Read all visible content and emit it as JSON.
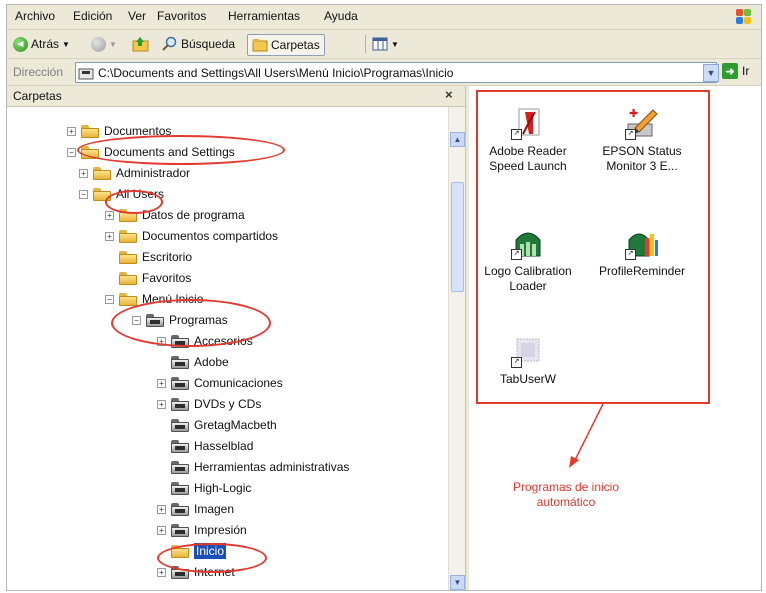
{
  "menubar": {
    "items": [
      "Archivo",
      "Edición",
      "Ver",
      "Favoritos",
      "Herramientas",
      "Ayuda"
    ]
  },
  "toolbar": {
    "back_label": "Atrás",
    "search_label": "Búsqueda",
    "folders_label": "Carpetas"
  },
  "address": {
    "label": "Dirección",
    "path": "C:\\Documents and Settings\\All Users\\Menú Inicio\\Programas\\Inicio",
    "go_label": "Ir"
  },
  "folders_pane": {
    "title": "Carpetas",
    "close": "×"
  },
  "tree": [
    {
      "label": "Documentos",
      "expander": "+",
      "type": "folder"
    },
    {
      "label": "Documents and Settings",
      "expander": "−",
      "type": "folder"
    },
    {
      "label": "Administrador",
      "expander": "+",
      "type": "folder"
    },
    {
      "label": "All Users",
      "expander": "−",
      "type": "folder"
    },
    {
      "label": "Datos de programa",
      "expander": "+",
      "type": "folder"
    },
    {
      "label": "Documentos compartidos",
      "expander": "+",
      "type": "folder"
    },
    {
      "label": "Escritorio",
      "expander": "",
      "type": "folder"
    },
    {
      "label": "Favoritos",
      "expander": "",
      "type": "folder"
    },
    {
      "label": "Menú Inicio",
      "expander": "−",
      "type": "folder"
    },
    {
      "label": "Programas",
      "expander": "−",
      "type": "prog"
    },
    {
      "label": "Accesorios",
      "expander": "+",
      "type": "prog"
    },
    {
      "label": "Adobe",
      "expander": "",
      "type": "prog"
    },
    {
      "label": "Comunicaciones",
      "expander": "+",
      "type": "prog"
    },
    {
      "label": "DVDs y CDs",
      "expander": "+",
      "type": "prog"
    },
    {
      "label": "GretagMacbeth",
      "expander": "",
      "type": "prog"
    },
    {
      "label": "Hasselblad",
      "expander": "",
      "type": "prog"
    },
    {
      "label": "Herramientas administrativas",
      "expander": "",
      "type": "prog"
    },
    {
      "label": "High-Logic",
      "expander": "",
      "type": "prog"
    },
    {
      "label": "Imagen",
      "expander": "+",
      "type": "prog"
    },
    {
      "label": "Impresión",
      "expander": "+",
      "type": "prog"
    },
    {
      "label": "Inicio",
      "expander": "",
      "type": "folder",
      "selected": true
    },
    {
      "label": "Internet",
      "expander": "+",
      "type": "prog"
    }
  ],
  "files": [
    {
      "name": "Adobe Reader Speed Launch",
      "line1": "Adobe Reader",
      "line2": "Speed Launch",
      "icon": "adobe-reader-icon"
    },
    {
      "name": "EPSON Status Monitor 3 E...",
      "line1": "EPSON Status",
      "line2": "Monitor 3 E...",
      "icon": "epson-status-monitor-icon"
    },
    {
      "name": "Logo Calibration Loader",
      "line1": "Logo Calibration",
      "line2": "Loader",
      "icon": "logo-calibration-loader-icon"
    },
    {
      "name": "ProfileReminder",
      "line1": "ProfileReminder",
      "line2": "",
      "icon": "profile-reminder-icon"
    },
    {
      "name": "TabUserW",
      "line1": "TabUserW",
      "line2": "",
      "icon": "tabuserw-icon"
    }
  ],
  "annotation": {
    "line1": "Programas de inicio",
    "line2": "automático",
    "color": "#e23a2f"
  }
}
